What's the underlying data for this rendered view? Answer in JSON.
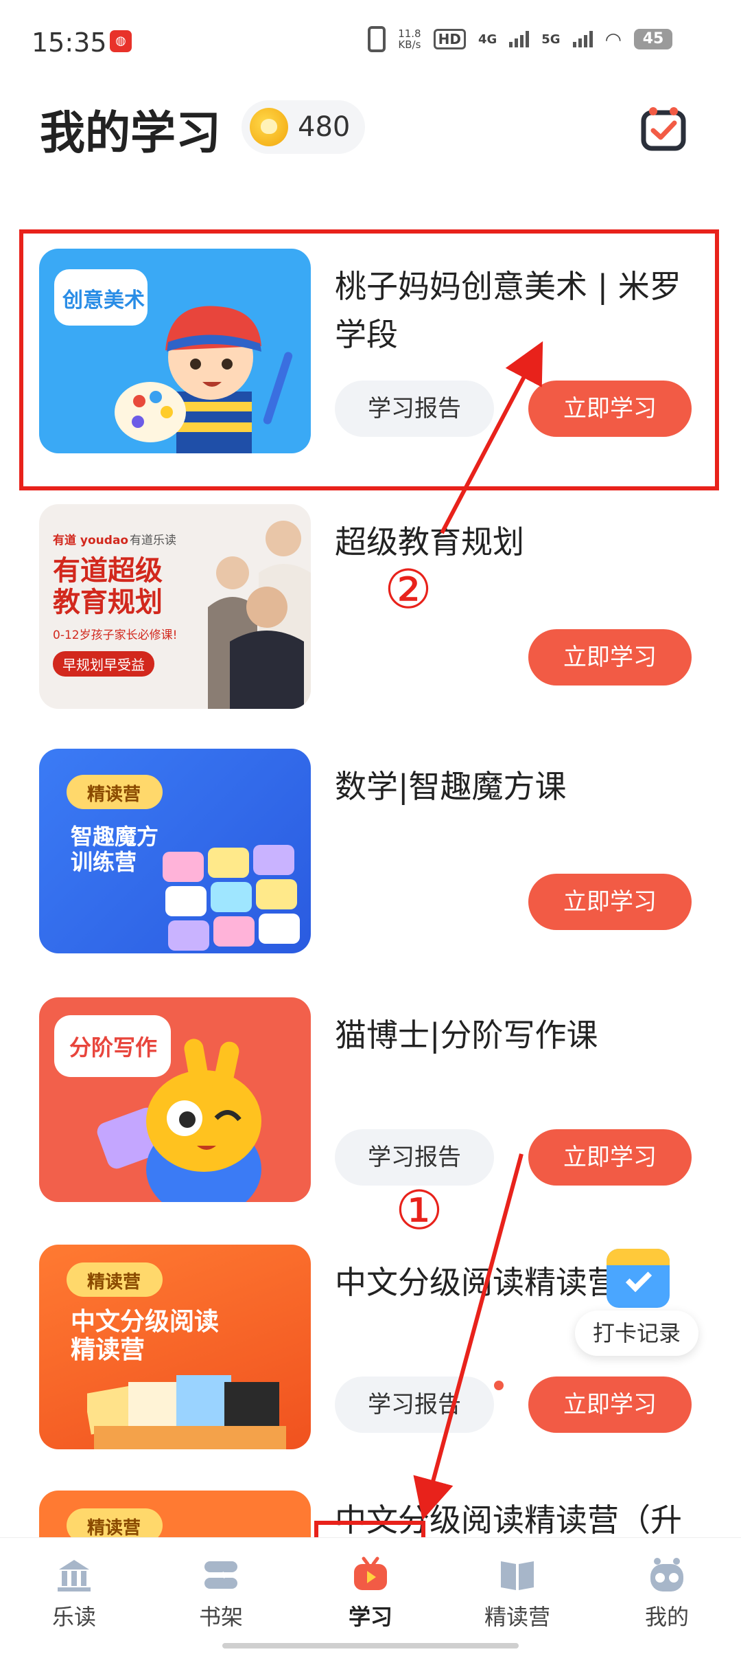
{
  "status_bar": {
    "time": "15:35",
    "speed": "11.8",
    "speed_unit": "KB/s",
    "hd": "HD",
    "sim1": "4G",
    "sim2": "5G",
    "battery": "45"
  },
  "header": {
    "title": "我的学习",
    "coins": "480"
  },
  "thumbs": {
    "art_tag": "创意美术",
    "edu_brand": "有道 youdao",
    "edu_brand2": "有道乐读",
    "edu_headline": "有道超级\n教育规划",
    "edu_sub": "0-12岁孩子家长必修课!",
    "edu_pill": "早规划早受益",
    "cube_badge": "精读营",
    "cube_text": "智趣魔方\n训练营",
    "writing_tag": "分阶写作",
    "reading_badge": "精读营",
    "reading_text": "中文分级阅读\n精读营",
    "last_badge": "精读营"
  },
  "courses": [
    {
      "title": "桃子妈妈创意美术 | 米罗学段",
      "report": "学习报告",
      "study": "立即学习"
    },
    {
      "title": "超级教育规划",
      "study": "立即学习"
    },
    {
      "title": "数学|智趣魔方课",
      "study": "立即学习"
    },
    {
      "title": "猫博士|分阶写作课",
      "report": "学习报告",
      "study": "立即学习"
    },
    {
      "title": "中文分级阅读精读营",
      "report": "学习报告",
      "study": "立即学习"
    },
    {
      "title": "中文分级阅读精读营（升"
    }
  ],
  "floating": {
    "checkin_label": "打卡记录"
  },
  "annotations": {
    "one": "①",
    "two": "②"
  },
  "nav": {
    "items": [
      {
        "label": "乐读",
        "icon": "library-icon"
      },
      {
        "label": "书架",
        "icon": "bookshelf-icon"
      },
      {
        "label": "学习",
        "icon": "study-tv-icon"
      },
      {
        "label": "精读营",
        "icon": "book-icon"
      },
      {
        "label": "我的",
        "icon": "robot-icon"
      }
    ]
  },
  "colors": {
    "accent": "#f25b45",
    "annotation": "#e8221b",
    "nav_active": "#f25b45",
    "nav_inactive": "#9fb0c6"
  }
}
